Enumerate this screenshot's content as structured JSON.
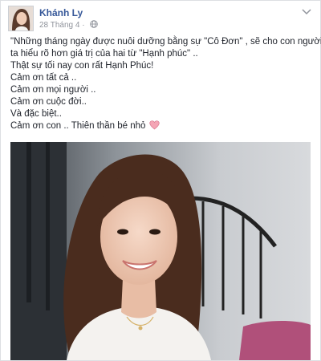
{
  "post": {
    "author": "Khánh Ly",
    "date": "28 Tháng 4",
    "date_separator": "·",
    "lines": [
      "\"Những tháng ngày được nuôi dưỡng bằng sự \"Cô Đơn\" , sẽ cho con người",
      "ta hiểu rõ hơn giá trị của hai từ \"Hạnh phúc\" ..",
      "Thật sự tối nay con rất Hạnh Phúc!",
      "Cảm ơn tất cả ..",
      "Cảm ơn mọi người ..",
      "Cảm ơn cuộc đời..",
      "Và đặc biệt..",
      "Cảm ơn con .. Thiên thần bé nhỏ"
    ]
  },
  "icons": {
    "audience": "globe-icon",
    "menu": "chevron-down-icon",
    "emoji": "heart-icon"
  },
  "colors": {
    "author_link": "#365899",
    "meta": "#90949c",
    "text": "#1d2129",
    "heart": "#f4a5b5"
  }
}
